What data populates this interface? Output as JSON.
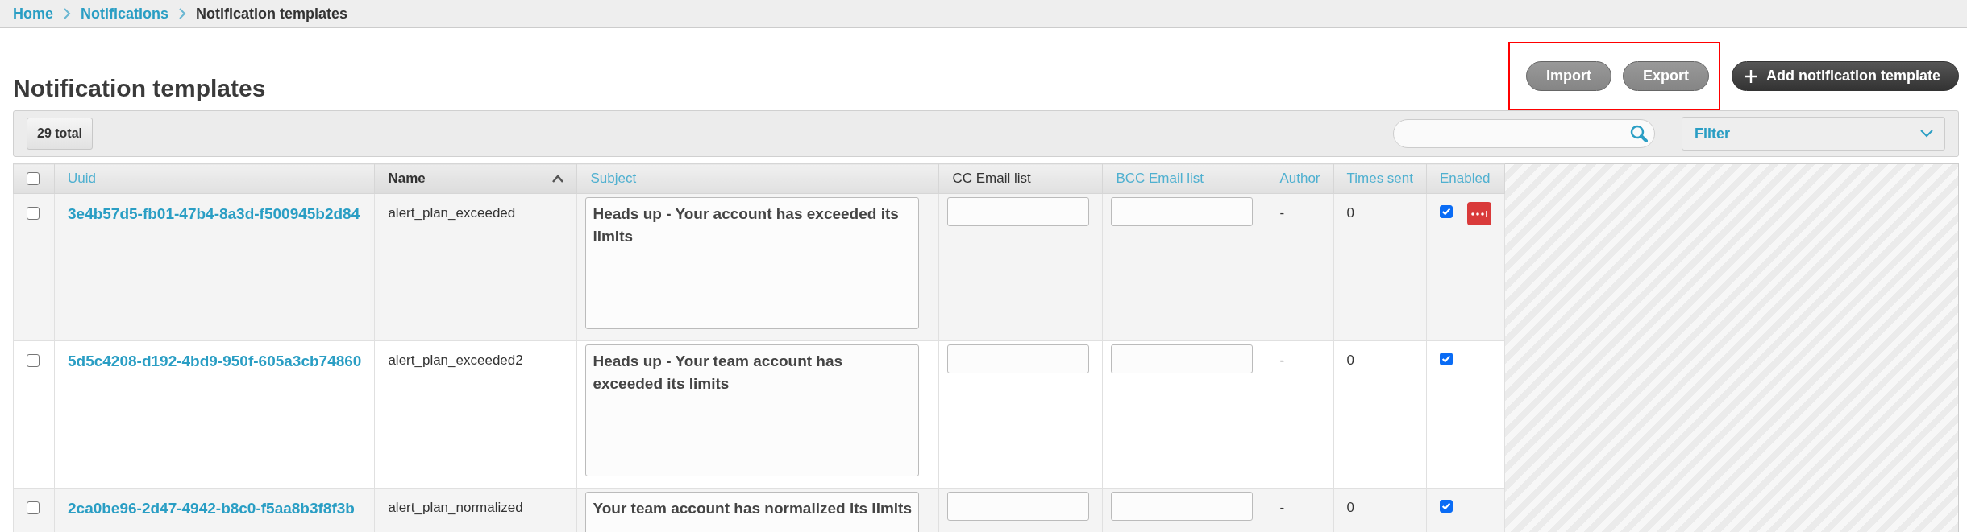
{
  "breadcrumb": [
    {
      "label": "Home",
      "link": true
    },
    {
      "label": "Notifications",
      "link": true
    },
    {
      "label": "Notification templates",
      "link": false
    }
  ],
  "title": "Notification templates",
  "actions": [
    {
      "label": "Import",
      "kind": "secondary",
      "highlighted": true
    },
    {
      "label": "Export",
      "kind": "secondary",
      "highlighted": true
    },
    {
      "label": "Add notification template",
      "kind": "primary",
      "highlighted": false
    }
  ],
  "toolbar": {
    "total": "29 total",
    "filter": "Filter"
  },
  "table": {
    "all_selected": false,
    "columns": [
      {
        "label": "Uuid",
        "sortable": true,
        "sorted": false
      },
      {
        "label": "Name",
        "sortable": false,
        "sorted": true
      },
      {
        "label": "Subject",
        "sortable": true,
        "sorted": false
      },
      {
        "label": "CC Email list",
        "sortable": false,
        "sorted": false
      },
      {
        "label": "BCC Email list",
        "sortable": true,
        "sorted": false
      },
      {
        "label": "Author",
        "sortable": true,
        "sorted": false
      },
      {
        "label": "Times sent",
        "sortable": true,
        "sorted": false
      },
      {
        "label": "Enabled",
        "sortable": true,
        "sorted": false
      }
    ],
    "rows": [
      {
        "selected": false,
        "uuid": "3e4b57d5-fb01-47b4-8a3d-f500945b2d84",
        "name": "alert_plan_exceeded",
        "subject": "Heads up - Your account has exceeded its limits",
        "author": "-",
        "times_sent": "0",
        "enabled": true,
        "actions_shown": true
      },
      {
        "selected": false,
        "uuid": "5d5c4208-d192-4bd9-950f-605a3cb74860",
        "name": "alert_plan_exceeded2",
        "subject": "Heads up - Your team account has exceeded its limits",
        "author": "-",
        "times_sent": "0",
        "enabled": true,
        "actions_shown": false
      },
      {
        "selected": false,
        "uuid": "2ca0be96-2d47-4942-b8c0-f5aa8b3f8f3b",
        "name": "alert_plan_normalized",
        "subject": "Your team account has normalized its limits",
        "author": "-",
        "times_sent": "0",
        "enabled": true,
        "actions_shown": false
      }
    ]
  }
}
